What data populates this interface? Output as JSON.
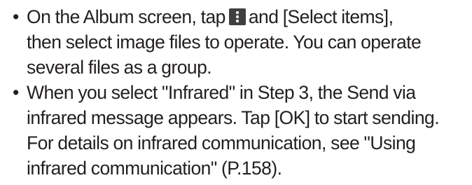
{
  "notes": [
    {
      "bullet": "•",
      "lines": [
        {
          "before_icon": "On the Album screen, tap",
          "icon": "menu-icon",
          "after_icon": "and [Select items],"
        },
        "then select image files to operate. You can operate",
        "several files as a group."
      ]
    },
    {
      "bullet": "•",
      "lines": [
        "When you select \"Infrared\" in Step 3, the Send via",
        "infrared message appears. Tap [OK] to start sending.",
        "For details on infrared communication, see \"Using",
        "infrared communication\" (P.158)."
      ]
    }
  ],
  "colors": {
    "text": "#231f20",
    "icon_background": "#3f3f3f",
    "icon_dots": "#e8e8e8"
  }
}
